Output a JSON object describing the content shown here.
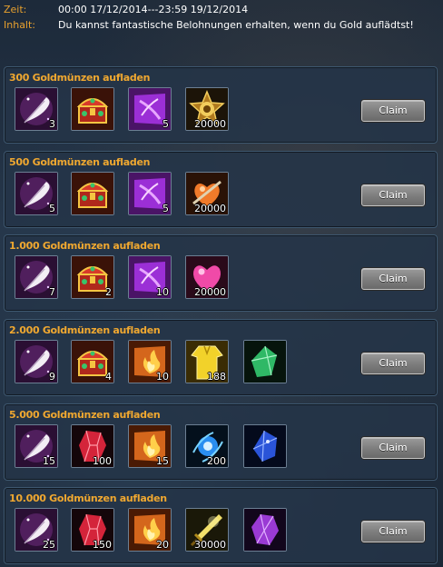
{
  "header": {
    "time_label": "Zeit:",
    "time_value": "00:00 17/12/2014---23:59 19/12/2014",
    "content_label": "Inhalt:",
    "content_value": "Du kannst fantastische Belohnungen erhalten, wenn du Gold auflädtst!"
  },
  "tiers": [
    {
      "title": "300 Goldmünzen aufladen",
      "claim_label": "Claim",
      "items": [
        {
          "icon": "feather-icon",
          "qty": "3"
        },
        {
          "icon": "treasure-chest-icon",
          "qty": ""
        },
        {
          "icon": "purple-scroll-icon",
          "qty": "5"
        },
        {
          "icon": "gold-badge-icon",
          "qty": "20000"
        }
      ]
    },
    {
      "title": "500 Goldmünzen aufladen",
      "claim_label": "Claim",
      "items": [
        {
          "icon": "feather-icon",
          "qty": "5"
        },
        {
          "icon": "treasure-chest-icon",
          "qty": ""
        },
        {
          "icon": "purple-scroll-icon",
          "qty": "5"
        },
        {
          "icon": "orange-heart-icon",
          "qty": "20000"
        }
      ]
    },
    {
      "title": "1.000 Goldmünzen aufladen",
      "claim_label": "Claim",
      "items": [
        {
          "icon": "feather-icon",
          "qty": "7"
        },
        {
          "icon": "treasure-chest-icon",
          "qty": "2"
        },
        {
          "icon": "purple-scroll-icon",
          "qty": "10"
        },
        {
          "icon": "pink-heart-icon",
          "qty": "20000"
        }
      ]
    },
    {
      "title": "2.000 Goldmünzen aufladen",
      "claim_label": "Claim",
      "items": [
        {
          "icon": "feather-icon",
          "qty": "9"
        },
        {
          "icon": "treasure-chest-icon",
          "qty": "4"
        },
        {
          "icon": "fire-scroll-icon",
          "qty": "10"
        },
        {
          "icon": "yellow-robe-icon",
          "qty": "188"
        },
        {
          "icon": "green-crystal-icon",
          "qty": ""
        }
      ]
    },
    {
      "title": "5.000 Goldmünzen aufladen",
      "claim_label": "Claim",
      "items": [
        {
          "icon": "feather-icon",
          "qty": "15"
        },
        {
          "icon": "red-gem-icon",
          "qty": "100"
        },
        {
          "icon": "fire-scroll-icon",
          "qty": "15"
        },
        {
          "icon": "blue-orb-icon",
          "qty": "200"
        },
        {
          "icon": "blue-crystal-icon",
          "qty": ""
        }
      ]
    },
    {
      "title": "10.000 Goldmünzen aufladen",
      "claim_label": "Claim",
      "items": [
        {
          "icon": "feather-icon",
          "qty": "25"
        },
        {
          "icon": "red-gem-icon",
          "qty": "150"
        },
        {
          "icon": "fire-scroll-icon",
          "qty": "20"
        },
        {
          "icon": "golden-sword-icon",
          "qty": "30000"
        },
        {
          "icon": "purple-crystal-icon",
          "qty": ""
        }
      ]
    }
  ],
  "colors": {
    "title_orange": "#f0a830",
    "label_orange": "#e8a12e",
    "panel_bg": "#243448",
    "claim_button": "#8a8a8a"
  }
}
